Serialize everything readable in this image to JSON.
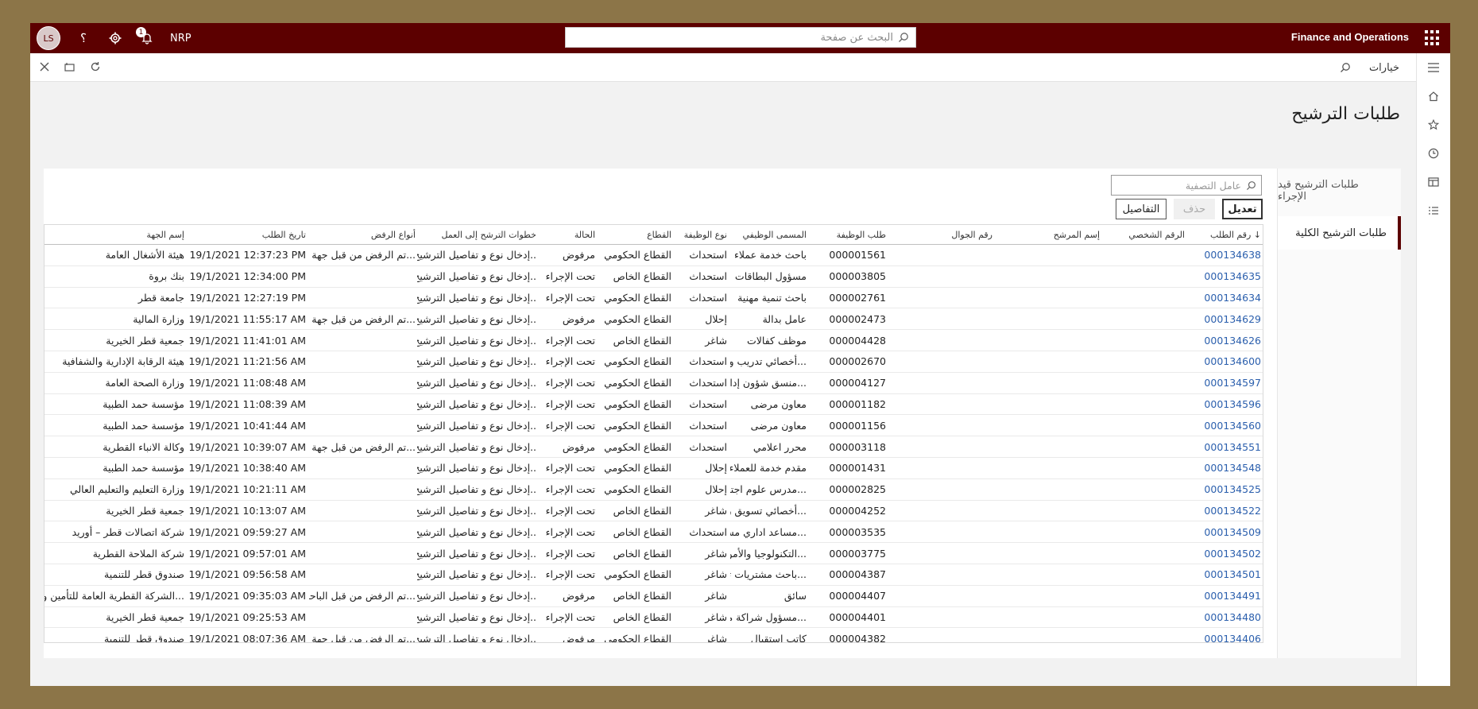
{
  "header": {
    "user_initials": "LS",
    "help_icon": "help-icon",
    "settings_icon": "gear-icon",
    "notifications_icon": "bell-icon",
    "notifications_count": "1",
    "company": "NRP",
    "search_placeholder": "البحث عن صفحة",
    "app_name": "Finance and Operations"
  },
  "actionbar": {
    "options_label": "خيارات"
  },
  "page": {
    "title": "طلبات الترشيح"
  },
  "tabs": [
    {
      "label": "طلبات الترشيح قيد الإجراء"
    },
    {
      "label": "طلبات الترشيح الكلية"
    }
  ],
  "toolbar": {
    "filter_placeholder": "عامل التصفية",
    "edit_label": "تعديل",
    "delete_label": "حذف",
    "details_label": "التفاصيل"
  },
  "table": {
    "columns": [
      "رقم الطلب ↓",
      "الرقم الشخصي",
      "إسم المرشح",
      "رقم الجوال",
      "طلب الوظيفة",
      "المسمى الوظيفي",
      "نوع الوظيفة",
      "القطاع",
      "الحالة",
      "خطوات الترشح إلى العمل",
      "أنواع الرفض",
      "تاريخ الطلب",
      "إسم الجهة"
    ],
    "rows": [
      [
        "000134638",
        "",
        "",
        "",
        "000001561",
        "باحث خدمة عملاء",
        "استحداث",
        "القطاع الحكومي",
        "مرفوض",
        "إدخال نوع و تفاصيل الترشيح..",
        "تم الرفض من قبل جهة...",
        "19/1/2021 12:37:23 PM",
        "هيئة الأشغال العامة"
      ],
      [
        "000134635",
        "",
        "",
        "",
        "000003805",
        "مسؤول البطاقات",
        "استحداث",
        "القطاع الخاص",
        "تحت الإجراء",
        "إدخال نوع و تفاصيل الترشيح..",
        "",
        "19/1/2021 12:34:00 PM",
        "بنك بروة"
      ],
      [
        "000134634",
        "",
        "",
        "",
        "000002761",
        "باحث تنمية مهنية",
        "استحداث",
        "القطاع الحكومي",
        "تحت الإجراء",
        "إدخال نوع و تفاصيل الترشيح..",
        "",
        "19/1/2021 12:27:19 PM",
        "جامعة قطر"
      ],
      [
        "000134629",
        "",
        "",
        "",
        "000002473",
        "عامل بدالة",
        "إحلال",
        "القطاع الحكومي",
        "مرفوض",
        "إدخال نوع و تفاصيل الترشيح..",
        "تم الرفض من قبل جهة...",
        "19/1/2021 11:55:17 AM",
        "وزارة المالية"
      ],
      [
        "000134626",
        "",
        "",
        "",
        "000004428",
        "موظف كفالات",
        "شاغر",
        "القطاع الخاص",
        "تحت الإجراء",
        "إدخال نوع و تفاصيل الترشيح..",
        "",
        "19/1/2021 11:41:01 AM",
        "جمعية قطر الخيرية"
      ],
      [
        "000134600",
        "",
        "",
        "",
        "000002670",
        "أخصائي تدريب وت...",
        "استحداث",
        "القطاع الحكومي",
        "تحت الإجراء",
        "إدخال نوع و تفاصيل الترشيح..",
        "",
        "19/1/2021 11:21:56 AM",
        "هيئة الرقابة الإدارية والشفافية"
      ],
      [
        "000134597",
        "",
        "",
        "",
        "000004127",
        "منسق شؤون إدار...",
        "استحداث",
        "القطاع الحكومي",
        "تحت الإجراء",
        "إدخال نوع و تفاصيل الترشيح..",
        "",
        "19/1/2021 11:08:48 AM",
        "وزارة الصحة العامة"
      ],
      [
        "000134596",
        "",
        "",
        "",
        "000001182",
        "معاون مرضى",
        "استحداث",
        "القطاع الحكومي",
        "تحت الإجراء",
        "إدخال نوع و تفاصيل الترشيح..",
        "",
        "19/1/2021 11:08:39 AM",
        "مؤسسة حمد الطبية"
      ],
      [
        "000134560",
        "",
        "",
        "",
        "000001156",
        "معاون مرضى",
        "استحداث",
        "القطاع الحكومي",
        "تحت الإجراء",
        "إدخال نوع و تفاصيل الترشيح..",
        "",
        "19/1/2021 10:41:44 AM",
        "مؤسسة حمد الطبية"
      ],
      [
        "000134551",
        "",
        "",
        "",
        "000003118",
        "محرر اعلامي",
        "استحداث",
        "القطاع الحكومي",
        "مرفوض",
        "إدخال نوع و تفاصيل الترشيح..",
        "تم الرفض من قبل جهة...",
        "19/1/2021 10:39:07 AM",
        "وكالة الانباء القطرية"
      ],
      [
        "000134548",
        "",
        "",
        "",
        "000001431",
        "مقدم خدمة للعملاء",
        "إحلال",
        "القطاع الحكومي",
        "تحت الإجراء",
        "إدخال نوع و تفاصيل الترشيح..",
        "",
        "19/1/2021 10:38:40 AM",
        "مؤسسة حمد الطبية"
      ],
      [
        "000134525",
        "",
        "",
        "",
        "000002825",
        "مدرس علوم اجتما...",
        "إحلال",
        "القطاع الحكومي",
        "تحت الإجراء",
        "إدخال نوع و تفاصيل الترشيح..",
        "",
        "19/1/2021 10:21:11 AM",
        "وزارة التعليم والتعليم العالي"
      ],
      [
        "000134522",
        "",
        "",
        "",
        "000004252",
        "أخصائي تسويق ر...",
        "شاغر",
        "القطاع الخاص",
        "تحت الإجراء",
        "إدخال نوع و تفاصيل الترشيح..",
        "",
        "19/1/2021 10:13:07 AM",
        "جمعية قطر الخيرية"
      ],
      [
        "000134509",
        "",
        "",
        "",
        "000003535",
        "مساعد اداري مسؤ...",
        "استحداث",
        "القطاع الخاص",
        "تحت الإجراء",
        "إدخال نوع و تفاصيل الترشيح..",
        "",
        "19/1/2021 09:59:27 AM",
        "شركة اتصالات قطر – أوريد"
      ],
      [
        "000134502",
        "",
        "",
        "",
        "000003775",
        "التكنولوجيا والأمن...",
        "شاغر",
        "القطاع الخاص",
        "تحت الإجراء",
        "إدخال نوع و تفاصيل الترشيح..",
        "",
        "19/1/2021 09:57:01 AM",
        "شركة الملاحة القطرية"
      ],
      [
        "000134501",
        "",
        "",
        "",
        "000004387",
        "باحث مشتريات ثان...",
        "شاغر",
        "القطاع الحكومي",
        "تحت الإجراء",
        "إدخال نوع و تفاصيل الترشيح..",
        "",
        "19/1/2021 09:56:58 AM",
        "صندوق قطر للتنمية"
      ],
      [
        "000134491",
        "",
        "",
        "",
        "000004407",
        "سائق",
        "شاغر",
        "القطاع الخاص",
        "مرفوض",
        "إدخال نوع و تفاصيل الترشيح..",
        "تم الرفض من قبل الباحـ...",
        "19/1/2021 09:35:03 AM",
        "الشركة القطرية العامة للتأمين وإعاد..."
      ],
      [
        "000134480",
        "",
        "",
        "",
        "000004401",
        "مسؤول شراكة مج...",
        "شاغر",
        "القطاع الخاص",
        "تحت الإجراء",
        "إدخال نوع و تفاصيل الترشيح..",
        "",
        "19/1/2021 09:25:53 AM",
        "جمعية قطر الخيرية"
      ],
      [
        "000134406",
        "",
        "",
        "",
        "000004382",
        "كاتب استقبال",
        "شاغر",
        "القطاع الحكومي",
        "مرفوض",
        "إدخال نوع و تفاصيل الترشيح..",
        "تم الرفض من قبل جهة...",
        "19/1/2021 08:07:36 AM",
        "صندوق قطر للتنمية"
      ]
    ]
  }
}
